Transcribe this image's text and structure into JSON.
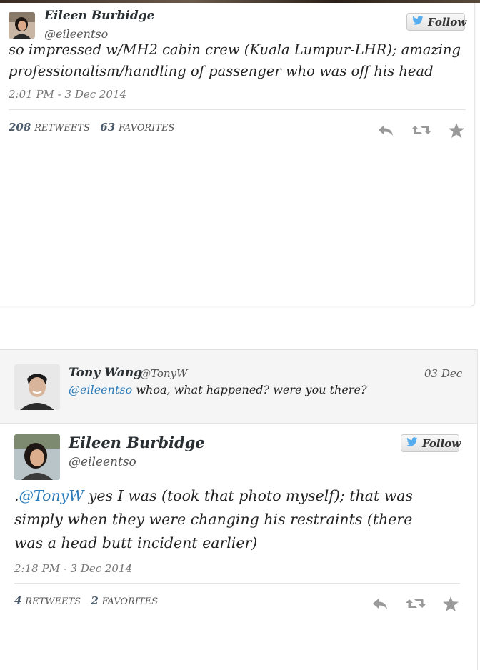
{
  "tweet1": {
    "name": "Eileen Burbidge",
    "handle": "@eileentso",
    "follow_label": "Follow",
    "text_line1": "so impressed w/MH2 cabin crew (Kuala Lumpur-LHR); amazing",
    "text_line2": "professionalism/handling of passenger who was off his head",
    "timestamp": "2:01 PM - 3 Dec 2014",
    "retweets_count": "208",
    "retweets_label": "RETWEETS",
    "favorites_count": "63",
    "favorites_label": "FAVORITES"
  },
  "reply": {
    "name": "Tony Wang",
    "handle": "@TonyW",
    "date": "03 Dec",
    "mention": "@eileentso",
    "text": "whoa, what happened? were you there?"
  },
  "tweet2": {
    "name": "Eileen Burbidge",
    "handle": "@eileentso",
    "follow_label": "Follow",
    "prefix": ".",
    "mention": "@TonyW",
    "text_line1": "yes I was (took that photo myself); that was",
    "text_line2": "simply when they were changing his restraints (there",
    "text_line3": "was a head butt incident earlier)",
    "timestamp": "2:18 PM - 3 Dec 2014",
    "retweets_count": "4",
    "retweets_label": "RETWEETS",
    "favorites_count": "2",
    "favorites_label": "FAVORITES"
  },
  "colors": {
    "twitter_blue": "#55acee",
    "link": "#2b7bb9",
    "icon_gray": "#999999"
  },
  "icons": [
    "twitter-bird-icon",
    "reply-icon",
    "retweet-icon",
    "favorite-star-icon"
  ]
}
